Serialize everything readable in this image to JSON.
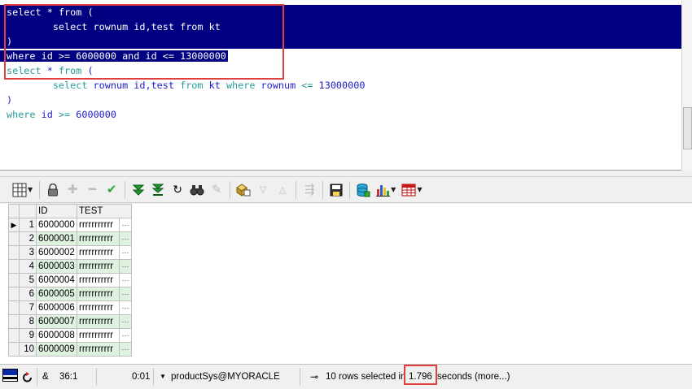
{
  "editor": {
    "query1": {
      "l1": {
        "kw1": "select",
        "t1": " * ",
        "kw2": "from",
        "t2": " ("
      },
      "l2": {
        "indent": "        ",
        "kw1": "select",
        "t1": " rownum id,test ",
        "kw2": "from",
        "t2": " kt"
      },
      "l3": {
        "t1": ")"
      },
      "l4": {
        "kw1": "where",
        "t1": " id >= ",
        "n1": "6000000",
        "t2": " ",
        "kw2": "and",
        "t3": " id <= ",
        "n2": "13000000"
      }
    },
    "query2": {
      "l1": {
        "kw1": "select",
        "t1": " * ",
        "kw2": "from",
        "t2": " ("
      },
      "l2": {
        "indent": "        ",
        "kw1": "select",
        "t1": " rownum id,test ",
        "kw2": "from",
        "t2": " kt ",
        "kw3": "where",
        "t3": " rownum ",
        "op": "<=",
        "t4": " ",
        "n1": "13000000"
      },
      "l3": {
        "t1": ")"
      },
      "l4": {
        "kw1": "where",
        "t1": " id ",
        "op": ">=",
        "t2": " ",
        "n1": "6000000"
      }
    },
    "selection_color": "#000080",
    "annotation_color": "#e04040"
  },
  "toolbar": {
    "icons": [
      "grid-icon",
      "lock-icon",
      "add-record-icon",
      "delete-record-icon",
      "post-changes-icon",
      "fetch-next-icon",
      "fetch-last-icon",
      "refresh-icon",
      "find-icon",
      "clear-icon",
      "query-by-example-icon",
      "sort-descending-icon",
      "sort-ascending-icon",
      "export-icon",
      "save-icon",
      "database-icon",
      "chart-icon",
      "table-icon"
    ]
  },
  "grid": {
    "columns": {
      "id": "ID",
      "test": "TEST"
    },
    "current_row_indicator": "▶",
    "rows": [
      {
        "n": "1",
        "id": "6000000",
        "test": "rrrrrrrrrrr",
        "more": "···"
      },
      {
        "n": "2",
        "id": "6000001",
        "test": "rrrrrrrrrrr",
        "more": "···"
      },
      {
        "n": "3",
        "id": "6000002",
        "test": "rrrrrrrrrrr",
        "more": "···"
      },
      {
        "n": "4",
        "id": "6000003",
        "test": "rrrrrrrrrrr",
        "more": "···"
      },
      {
        "n": "5",
        "id": "6000004",
        "test": "rrrrrrrrrrr",
        "more": "···"
      },
      {
        "n": "6",
        "id": "6000005",
        "test": "rrrrrrrrrrr",
        "more": "···"
      },
      {
        "n": "7",
        "id": "6000006",
        "test": "rrrrrrrrrrr",
        "more": "···"
      },
      {
        "n": "8",
        "id": "6000007",
        "test": "rrrrrrrrrrr",
        "more": "···"
      },
      {
        "n": "9",
        "id": "6000008",
        "test": "rrrrrrrrrrr",
        "more": "···"
      },
      {
        "n": "10",
        "id": "6000009",
        "test": "rrrrrrrrrrr",
        "more": "···"
      }
    ],
    "alt_row_color": "#dff2df"
  },
  "status": {
    "mode": "&",
    "position": "36:1",
    "elapsed": "0:01",
    "connection": "productSys@MYORACLE",
    "rows_selected_prefix": "10 rows selected in",
    "time": "1.796",
    "rows_selected_suffix": "seconds (more...)"
  }
}
